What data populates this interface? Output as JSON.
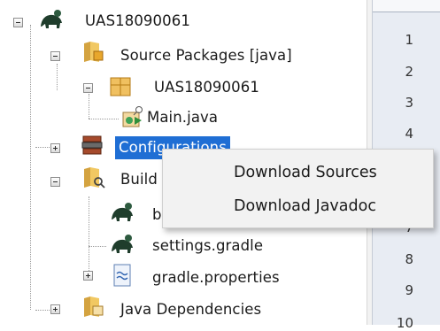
{
  "tree": {
    "project": "UAS18090061",
    "source_packages": "Source Packages [java]",
    "package": "UAS18090061",
    "main_file": "Main.java",
    "configurations": "Configurations",
    "build_scripts": "Build",
    "build_gradle": "b",
    "settings_gradle": "settings.gradle",
    "gradle_properties": "gradle.properties",
    "java_dependencies": "Java Dependencies"
  },
  "editor": {
    "line_numbers": [
      "1",
      "2",
      "3",
      "4",
      "5",
      "6",
      "7",
      "8",
      "9",
      "10"
    ]
  },
  "context_menu": {
    "items": [
      "Download Sources",
      "Download Javadoc"
    ]
  },
  "colors": {
    "selection": "#1f6ed4",
    "menu_background": "#f2f2f2",
    "gutter_background": "#e8ecf3"
  }
}
